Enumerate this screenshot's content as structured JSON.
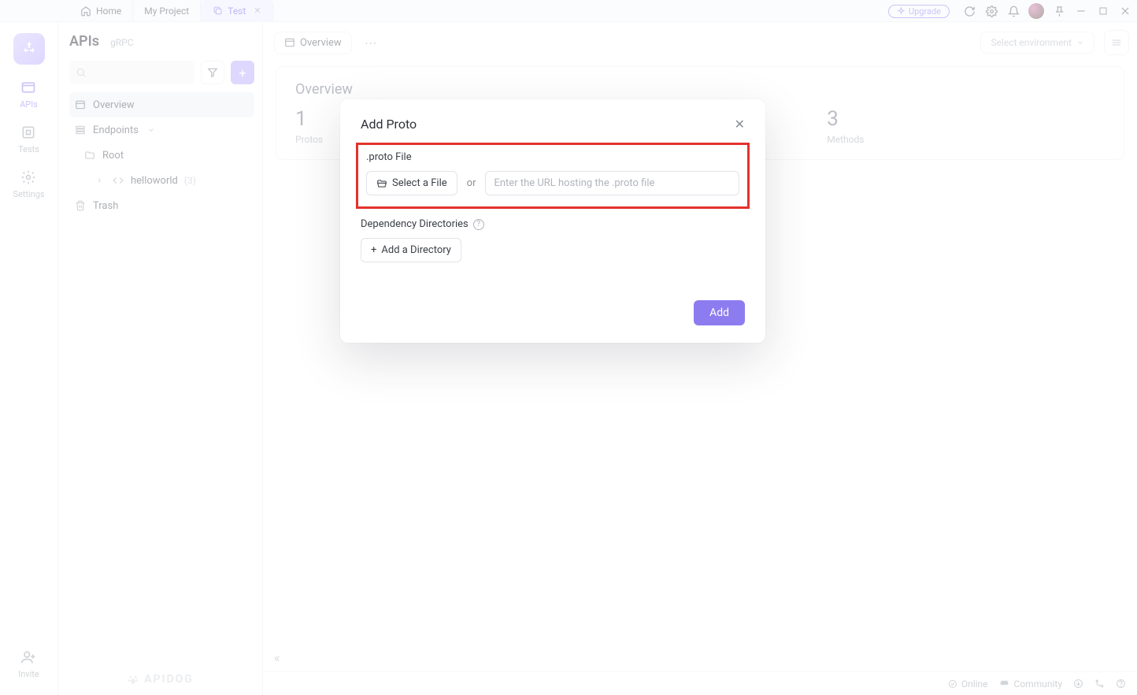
{
  "tabs": {
    "home": "Home",
    "project": "My Project",
    "test": "Test"
  },
  "topbar": {
    "upgrade": "Upgrade"
  },
  "leftnav": {
    "apis": "APIs",
    "tests": "Tests",
    "settings": "Settings",
    "invite": "Invite"
  },
  "sidebar": {
    "title": "APIs",
    "subtitle": "gRPC",
    "overview": "Overview",
    "endpoints": "Endpoints",
    "root": "Root",
    "helloworld": "helloworld",
    "helloworld_count": "(3)",
    "trash": "Trash",
    "brand": "APIDOG"
  },
  "main": {
    "overview_tab": "Overview",
    "env_placeholder": "Select environment",
    "overview_heading": "Overview",
    "stats": [
      {
        "value": "1",
        "label": "Protos"
      },
      {
        "value": "3",
        "label": "Methods"
      }
    ]
  },
  "modal": {
    "title": "Add Proto",
    "proto_file_label": ".proto File",
    "select_file": "Select a File",
    "or": "or",
    "url_placeholder": "Enter the URL hosting the .proto file",
    "dep_label": "Dependency Directories",
    "add_dir": "Add a Directory",
    "add": "Add"
  },
  "statusbar": {
    "online": "Online",
    "community": "Community"
  }
}
